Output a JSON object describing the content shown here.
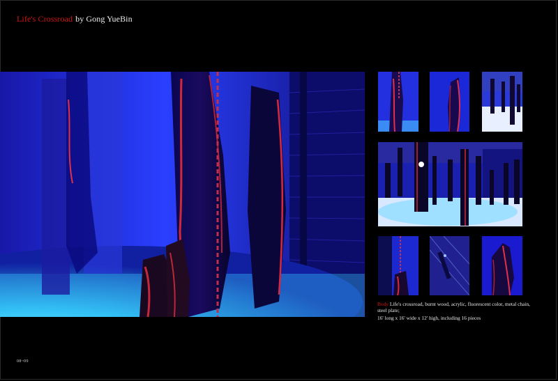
{
  "header": {
    "title_artwork": "Life's Crossroad",
    "title_byline": "by Gong YueBin"
  },
  "caption": {
    "label": "Body",
    "line1": "Life's crossroad, burnt wood, acrylic, fluorescent color, metal chain, steel plate;",
    "line2": "16' long x 16' wide x 12' high, including 16 pieces"
  },
  "folio": "08~09",
  "colors": {
    "background": "#000000",
    "title_accent": "#d21414",
    "uv_blue": "#1a1ad0",
    "floor_cyan": "#3fd6ff",
    "wood_red": "#c8283a"
  }
}
